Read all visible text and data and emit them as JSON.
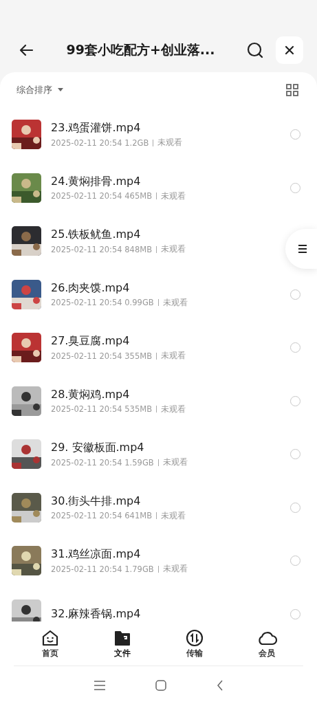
{
  "header": {
    "title": "99套小吃配方+创业落..."
  },
  "toolbar": {
    "sort_label": "综合排序"
  },
  "files": [
    {
      "name": "23.鸡蛋灌饼.mp4",
      "date": "2025-02-11 20:54",
      "size": "1.2GB",
      "status": "未观看",
      "selected": false
    },
    {
      "name": "24.黄焖排骨.mp4",
      "date": "2025-02-11 20:54",
      "size": "465MB",
      "status": "未观看",
      "selected": false
    },
    {
      "name": "25.铁板鱿鱼.mp4",
      "date": "2025-02-11 20:54",
      "size": "848MB",
      "status": "未观看"
    },
    {
      "name": "26.肉夹馍.mp4",
      "date": "2025-02-11 20:54",
      "size": "0.99GB",
      "status": "未观看",
      "selected": false
    },
    {
      "name": "27.臭豆腐.mp4",
      "date": "2025-02-11 20:54",
      "size": "355MB",
      "status": "未观看",
      "selected": false
    },
    {
      "name": "28.黄焖鸡.mp4",
      "date": "2025-02-11 20:54",
      "size": "535MB",
      "status": "未观看",
      "selected": false
    },
    {
      "name": "29. 安徽板面.mp4",
      "date": "2025-02-11 20:54",
      "size": "1.59GB",
      "status": "未观看",
      "selected": false
    },
    {
      "name": "30.街头牛排.mp4",
      "date": "2025-02-11 20:54",
      "size": "641MB",
      "status": "未观看",
      "selected": false
    },
    {
      "name": "31.鸡丝凉面.mp4",
      "date": "2025-02-11 20:54",
      "size": "1.79GB",
      "status": "未观看",
      "selected": false
    },
    {
      "name": "32.麻辣香锅.mp4",
      "selected": false
    }
  ],
  "tabs": [
    {
      "label": "首页",
      "selected": false
    },
    {
      "label": "文件",
      "selected": true
    },
    {
      "label": "传输",
      "selected": false
    },
    {
      "label": "会员",
      "selected": false
    }
  ]
}
